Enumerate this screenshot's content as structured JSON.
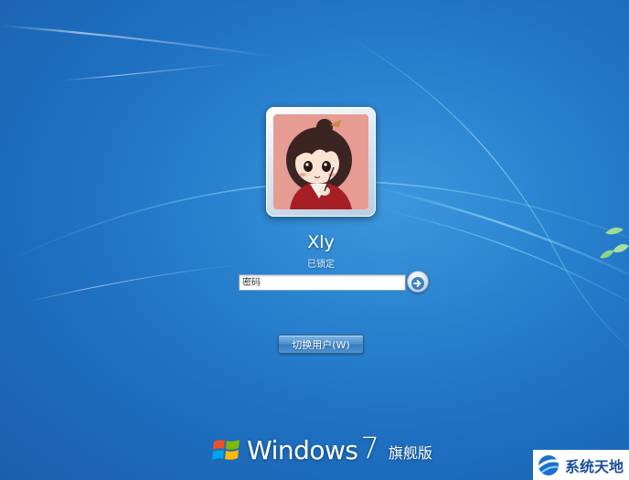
{
  "user": {
    "name": "Xly",
    "status": "已锁定"
  },
  "password": {
    "placeholder": "密码"
  },
  "buttons": {
    "switch_user_label": "切换用户(W)"
  },
  "branding": {
    "product": "Windows",
    "version": "7",
    "edition": "旗舰版"
  },
  "watermark": {
    "text": "系统天地"
  },
  "icons": {
    "submit": "arrow-right-icon",
    "logo": "windows-flag-icon",
    "watermark_logo": "xitongtiandi-logo-icon"
  },
  "colors": {
    "background": "#2a83cf",
    "avatar_bg": "#e79c93",
    "watermark_text": "#1a4f9c"
  }
}
